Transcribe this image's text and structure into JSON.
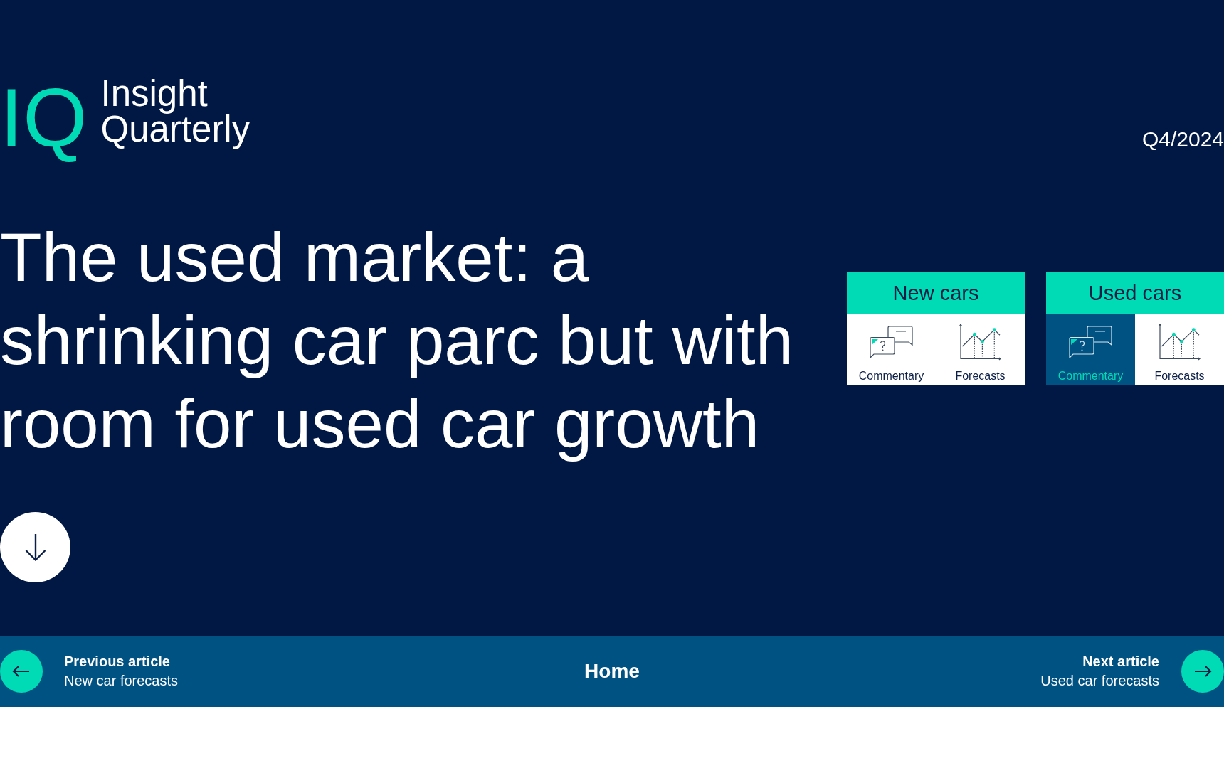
{
  "header": {
    "logo": {
      "mark": "IQ",
      "title_lines": [
        "Insight",
        "Quarterly"
      ]
    },
    "issue": "Q4/2024"
  },
  "headline": "The used market: a shrinking car parc but with room for used car growth",
  "sections": [
    {
      "title": "New cars",
      "links": [
        {
          "kind": "commentary",
          "label": "Commentary",
          "selected": false
        },
        {
          "kind": "forecasts",
          "label": "Forecasts",
          "selected": false
        }
      ]
    },
    {
      "title": "Used cars",
      "links": [
        {
          "kind": "commentary",
          "label": "Commentary",
          "selected": true
        },
        {
          "kind": "forecasts",
          "label": "Forecasts",
          "selected": false
        }
      ]
    }
  ],
  "footer": {
    "previous": {
      "heading": "Previous article",
      "title": "New car forecasts"
    },
    "home": "Home",
    "next": {
      "heading": "Next article",
      "title": "Used car forecasts"
    }
  }
}
